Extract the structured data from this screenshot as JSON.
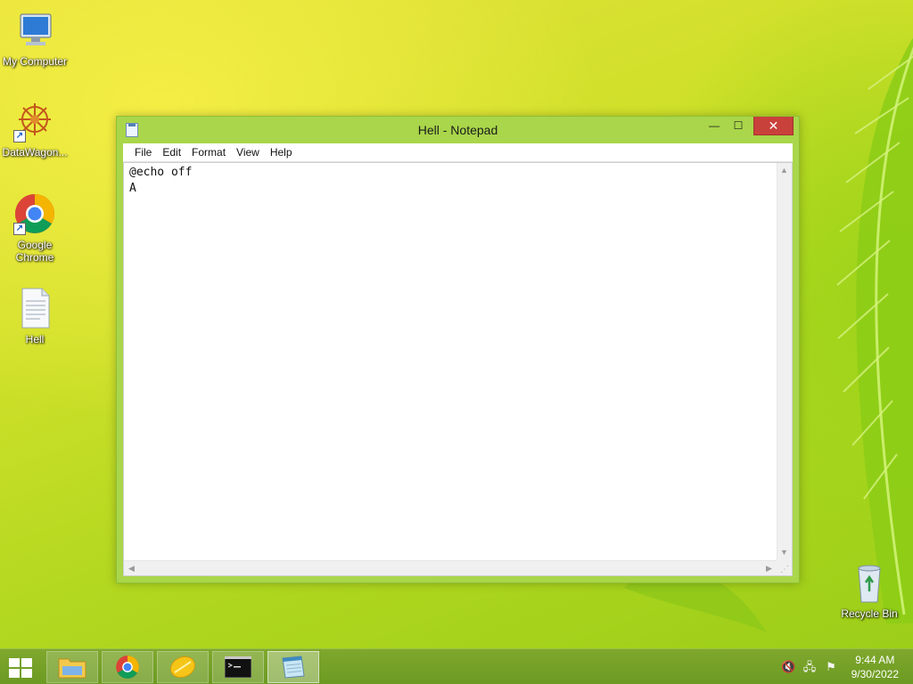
{
  "desktop": {
    "icons": [
      {
        "label": "My Computer",
        "icon": "computer-icon"
      },
      {
        "label": "DataWagon...",
        "icon": "datawagon-icon"
      },
      {
        "label": "Google Chrome",
        "icon": "chrome-icon"
      },
      {
        "label": "Hell",
        "icon": "text-file-icon"
      },
      {
        "label": "Recycle Bin",
        "icon": "recycle-bin-icon"
      }
    ]
  },
  "window": {
    "title": "Hell - Notepad",
    "controls": {
      "minimize": "—",
      "maximize": "☐",
      "close": "✕"
    },
    "menu": [
      "File",
      "Edit",
      "Format",
      "View",
      "Help"
    ],
    "content": "@echo off\nA"
  },
  "taskbar": {
    "apps": [
      {
        "name": "file-explorer-icon",
        "active": false
      },
      {
        "name": "chrome-icon",
        "active": false
      },
      {
        "name": "lemon-app-icon",
        "active": false
      },
      {
        "name": "command-prompt-icon",
        "active": false
      },
      {
        "name": "notepad-icon",
        "active": true
      }
    ],
    "tray": {
      "icons": [
        "volume-muted-icon",
        "network-icon",
        "action-center-flag-icon"
      ],
      "time": "9:44 AM",
      "date": "9/30/2022"
    }
  },
  "colors": {
    "window_frame": "#a9d64a",
    "close_button": "#c9413b",
    "taskbar": "#6c9a22"
  }
}
